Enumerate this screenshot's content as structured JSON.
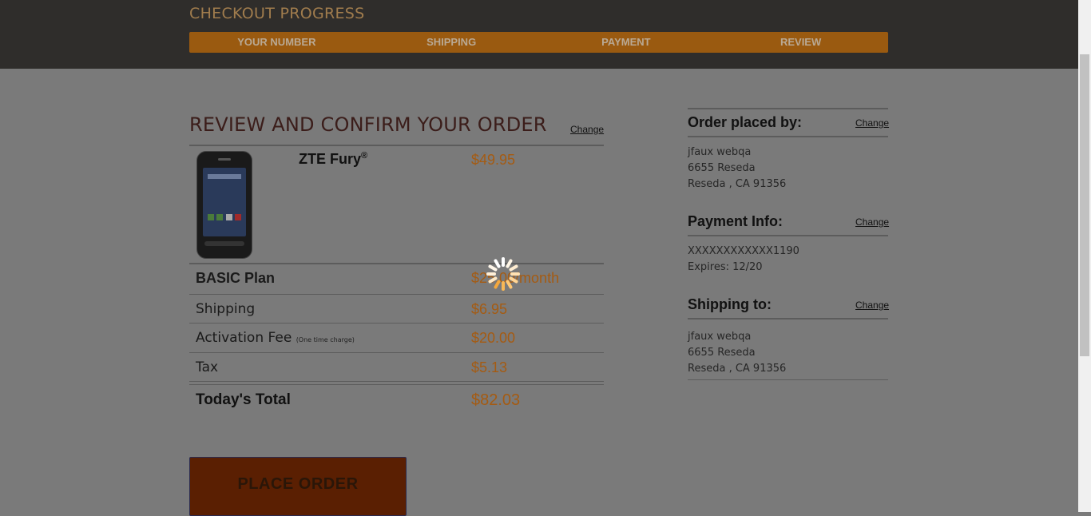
{
  "header": {
    "progress_title": "CHECKOUT PROGRESS",
    "steps": [
      "YOUR NUMBER",
      "SHIPPING",
      "PAYMENT",
      "REVIEW"
    ]
  },
  "review": {
    "title": "REVIEW AND CONFIRM YOUR ORDER",
    "change": "Change",
    "product_name": "ZTE Fury",
    "product_mark": "®",
    "product_price": "$49.95",
    "plan_label": "BASIC Plan",
    "plan_price": "$25.00/month",
    "shipping_label": "Shipping",
    "shipping_price": "$6.95",
    "activation_label": "Activation Fee",
    "activation_note": "(One time charge)",
    "activation_price": "$20.00",
    "tax_label": "Tax",
    "tax_price": "$5.13",
    "total_label": "Today's Total",
    "total_price": "$82.03",
    "place_order": "PLACE ORDER"
  },
  "sidebar": {
    "order_by_title": "Order placed by:",
    "order_by_change": "Change",
    "order_by_lines": [
      "jfaux webqa",
      "6655 Reseda",
      "Reseda , CA 91356"
    ],
    "payment_title": "Payment Info:",
    "payment_change": "Change",
    "payment_lines": [
      "XXXXXXXXXXXX1190",
      "Expires: 12/20"
    ],
    "shipping_title": "Shipping to:",
    "shipping_change": "Change",
    "shipping_lines": [
      "jfaux webqa",
      "6655 Reseda",
      "Reseda , CA 91356"
    ]
  },
  "colors": {
    "accent": "#a55b12",
    "progress_bar": "#9a5a10",
    "header_bg": "#2f2d2b",
    "overlay_bg": "#7a7a7a",
    "button_bg": "#5a1f02"
  }
}
